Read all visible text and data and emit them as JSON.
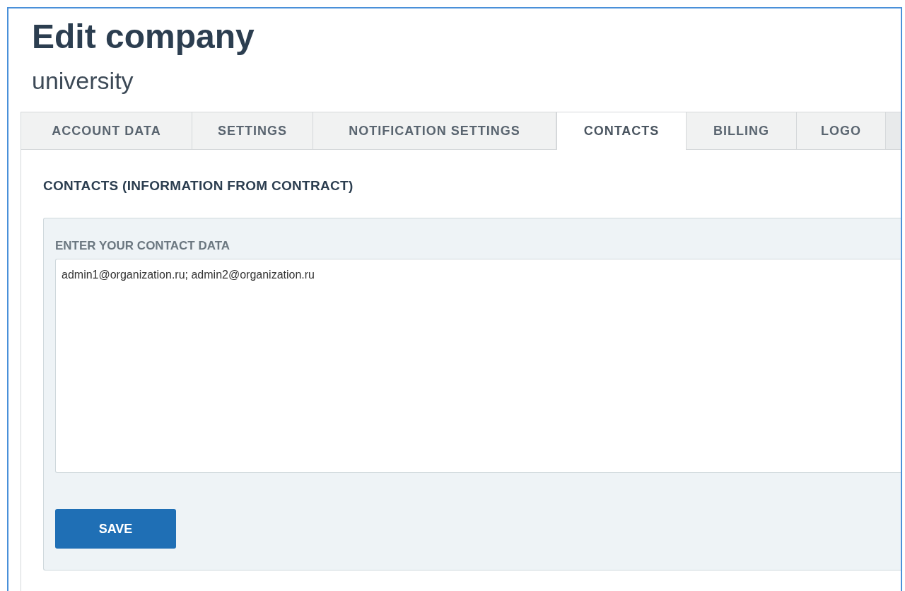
{
  "page": {
    "title": "Edit company",
    "subtitle": "university"
  },
  "tabs": [
    {
      "label": "ACCOUNT DATA",
      "selected": false
    },
    {
      "label": "SETTINGS",
      "selected": false
    },
    {
      "label": "NOTIFICATION SETTINGS",
      "selected": false
    },
    {
      "label": "CONTACTS",
      "selected": true
    },
    {
      "label": "BILLING",
      "selected": false
    },
    {
      "label": "LOGO",
      "selected": false
    }
  ],
  "section": {
    "heading": "CONTACTS (INFORMATION FROM CONTRACT)",
    "field_label": "ENTER YOUR CONTACT DATA",
    "field_value": "admin1@organization.ru; admin2@organization.ru",
    "button": "SAVE"
  }
}
